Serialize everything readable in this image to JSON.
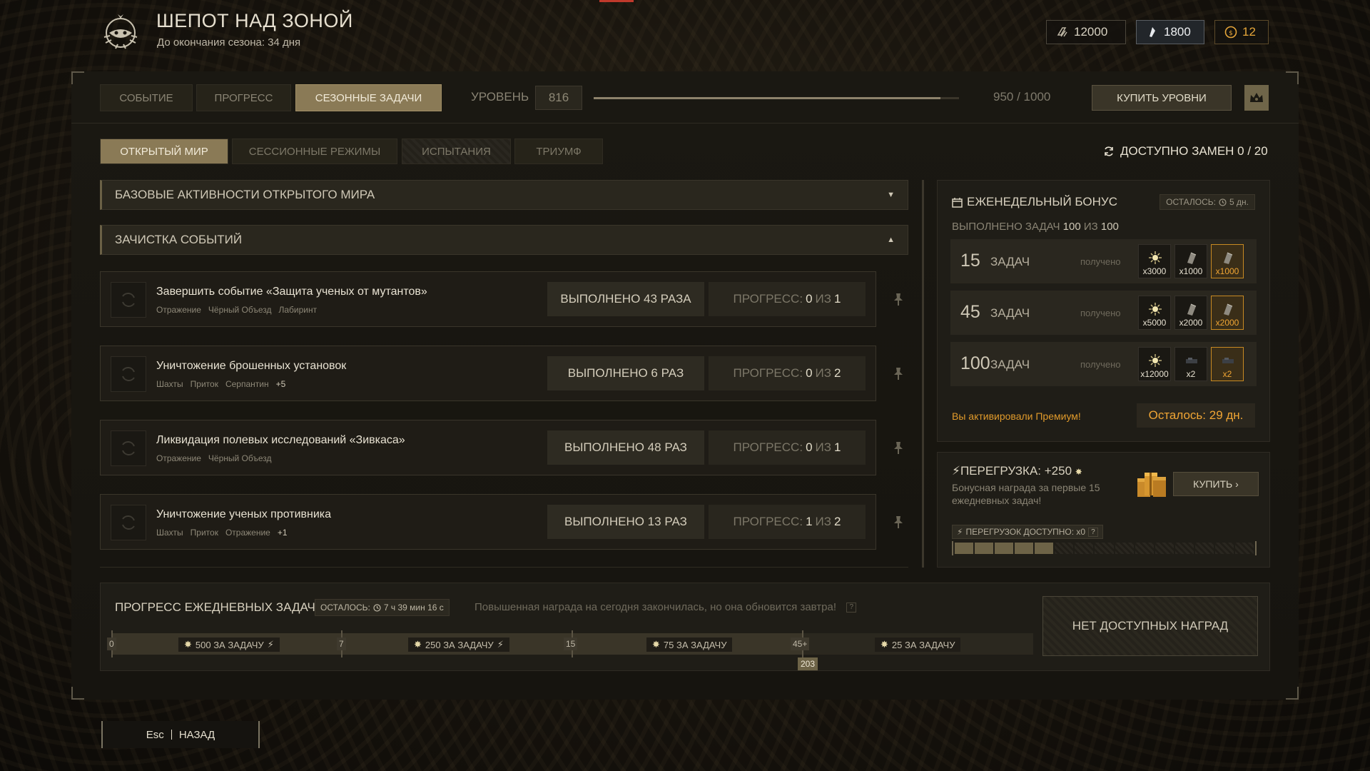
{
  "header": {
    "title": "ШЕПОТ НАД ЗОНОЙ",
    "subtitle": "До окончания сезона: 34 дня",
    "currencies": [
      {
        "icon": "rubles-icon",
        "value": "12000"
      },
      {
        "icon": "crystal-icon",
        "value": "1800"
      },
      {
        "icon": "coin-icon",
        "value": "12"
      }
    ]
  },
  "tabs": [
    "СОБЫТИЕ",
    "ПРОГРЕСС",
    "СЕЗОННЫЕ ЗАДАЧИ"
  ],
  "level": {
    "label": "УРОВЕНЬ",
    "value": "816",
    "xp_text": "950 / 1000",
    "xp_fraction": 0.95
  },
  "buy_levels": "КУПИТЬ УРОВНИ",
  "subtabs": [
    "ОТКРЫТЫЙ МИР",
    "СЕССИОННЫЕ РЕЖИМЫ",
    "ИСПЫТАНИЯ",
    "ТРИУМФ"
  ],
  "swaps": "ДОСТУПНО ЗАМЕН 0 / 20",
  "sections": {
    "basic": "БАЗОВЫЕ АКТИВНОСТИ ОТКРЫТОГО МИРА",
    "events": "ЗАЧИСТКА СОБЫТИЙ"
  },
  "tasks": [
    {
      "name": "Завершить событие «Защита ученых от мутантов»",
      "tags": [
        "Отражение",
        "Чёрный Объезд",
        "Лабиринт"
      ],
      "more": "",
      "done": "ВЫПОЛНЕНО 43 РАЗА",
      "progress_label": "ПРОГРЕСС:",
      "progress_cur": "0",
      "progress_of": "ИЗ",
      "progress_max": "1"
    },
    {
      "name": "Уничтожение брошенных установок",
      "tags": [
        "Шахты",
        "Приток",
        "Серпантин"
      ],
      "more": "+5",
      "done": "ВЫПОЛНЕНО 6 РАЗ",
      "progress_label": "ПРОГРЕСС:",
      "progress_cur": "0",
      "progress_of": "ИЗ",
      "progress_max": "2"
    },
    {
      "name": "Ликвидация полевых исследований «Зивкаса»",
      "tags": [
        "Отражение",
        "Чёрный Объезд"
      ],
      "more": "",
      "done": "ВЫПОЛНЕНО 48 РАЗ",
      "progress_label": "ПРОГРЕСС:",
      "progress_cur": "0",
      "progress_of": "ИЗ",
      "progress_max": "1"
    },
    {
      "name": "Уничтожение ученых противника",
      "tags": [
        "Шахты",
        "Приток",
        "Отражение"
      ],
      "more": "+1",
      "done": "ВЫПОЛНЕНО 13 РАЗ",
      "progress_label": "ПРОГРЕСС:",
      "progress_cur": "1",
      "progress_of": "ИЗ",
      "progress_max": "2"
    }
  ],
  "weekly": {
    "title": "ЕЖЕНЕДЕЛЬНЫЙ БОНУС",
    "left": "ОСТАЛОСЬ:",
    "left_value": "5 дн.",
    "done_label": "ВЫПОЛНЕНО ЗАДАЧ",
    "done_value": "100",
    "done_of": "ИЗ",
    "done_total": "100",
    "tiers": [
      {
        "num": "15",
        "label": "ЗАДАЧ",
        "status": "получено",
        "rewards": [
          "x3000",
          "x1000",
          "x1000"
        ]
      },
      {
        "num": "45",
        "label": "ЗАДАЧ",
        "status": "получено",
        "rewards": [
          "x5000",
          "x2000",
          "x2000"
        ]
      },
      {
        "num": "100",
        "label": "ЗАДАЧ",
        "status": "получено",
        "rewards": [
          "x12000",
          "x2",
          "x2"
        ]
      }
    ],
    "premium_text": "Вы активировали Премиум!",
    "premium_left": "Осталось: 29 дн."
  },
  "overload": {
    "title": "ПЕРЕГРУЗКА: +250",
    "desc": "Бонусная награда за первые 15 ежедневных задач!",
    "buy": "КУПИТЬ",
    "available": "ПЕРЕГРУЗОК ДОСТУПНО: x0",
    "help": "?",
    "filled_segments": 5,
    "total_segments": 15
  },
  "daily": {
    "title": "ПРОГРЕСС ЕЖЕДНЕВНЫХ ЗАДАЧ",
    "left": "ОСТАЛОСЬ:",
    "left_value": "7 ч 39 мин 16 с",
    "info": "Повышенная награда на сегодня закончилась, но она обновится завтра!",
    "help": "?",
    "marks": [
      "0",
      "7",
      "15",
      "45+"
    ],
    "segments": [
      "500 ЗА ЗАДАЧУ",
      "250 ЗА ЗАДАЧУ",
      "75 ЗА ЗАДАЧУ",
      "25 ЗА ЗАДАЧУ"
    ],
    "current": "203",
    "no_rewards": "НЕТ ДОСТУПНЫХ НАГРАД"
  },
  "back": {
    "key": "Esc",
    "label": "НАЗАД"
  }
}
